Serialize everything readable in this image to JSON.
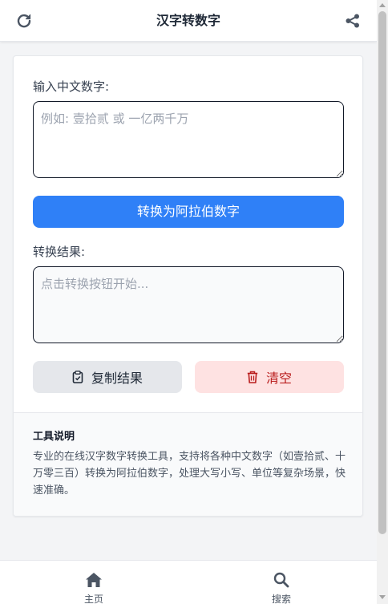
{
  "header": {
    "title": "汉字转数字",
    "left_icon": "refresh-icon",
    "right_icon": "share-icon"
  },
  "converter": {
    "input_label": "输入中文数字:",
    "input_placeholder": "例如: 壹拾贰 或 一亿两千万",
    "input_value": "",
    "convert_button": "转换为阿拉伯数字",
    "result_label": "转换结果:",
    "result_placeholder": "点击转换按钮开始...",
    "result_value": "",
    "copy_button": "复制结果",
    "copy_icon": "clipboard-icon",
    "clear_button": "清空",
    "clear_icon": "trash-icon"
  },
  "info": {
    "title": "工具说明",
    "text": "专业的在线汉字数字转换工具，支持将各种中文数字（如壹拾贰、十万零三百）转换为阿拉伯数字，处理大写小写、单位等复杂场景，快速准确。"
  },
  "bottom_nav": {
    "items": [
      {
        "label": "主页",
        "icon": "home-icon"
      },
      {
        "label": "搜索",
        "icon": "search-icon"
      }
    ]
  },
  "colors": {
    "primary": "#2f80f7",
    "danger_bg": "#fee2e2",
    "danger_text": "#b91c1c",
    "neutral_button": "#e5e7eb"
  }
}
